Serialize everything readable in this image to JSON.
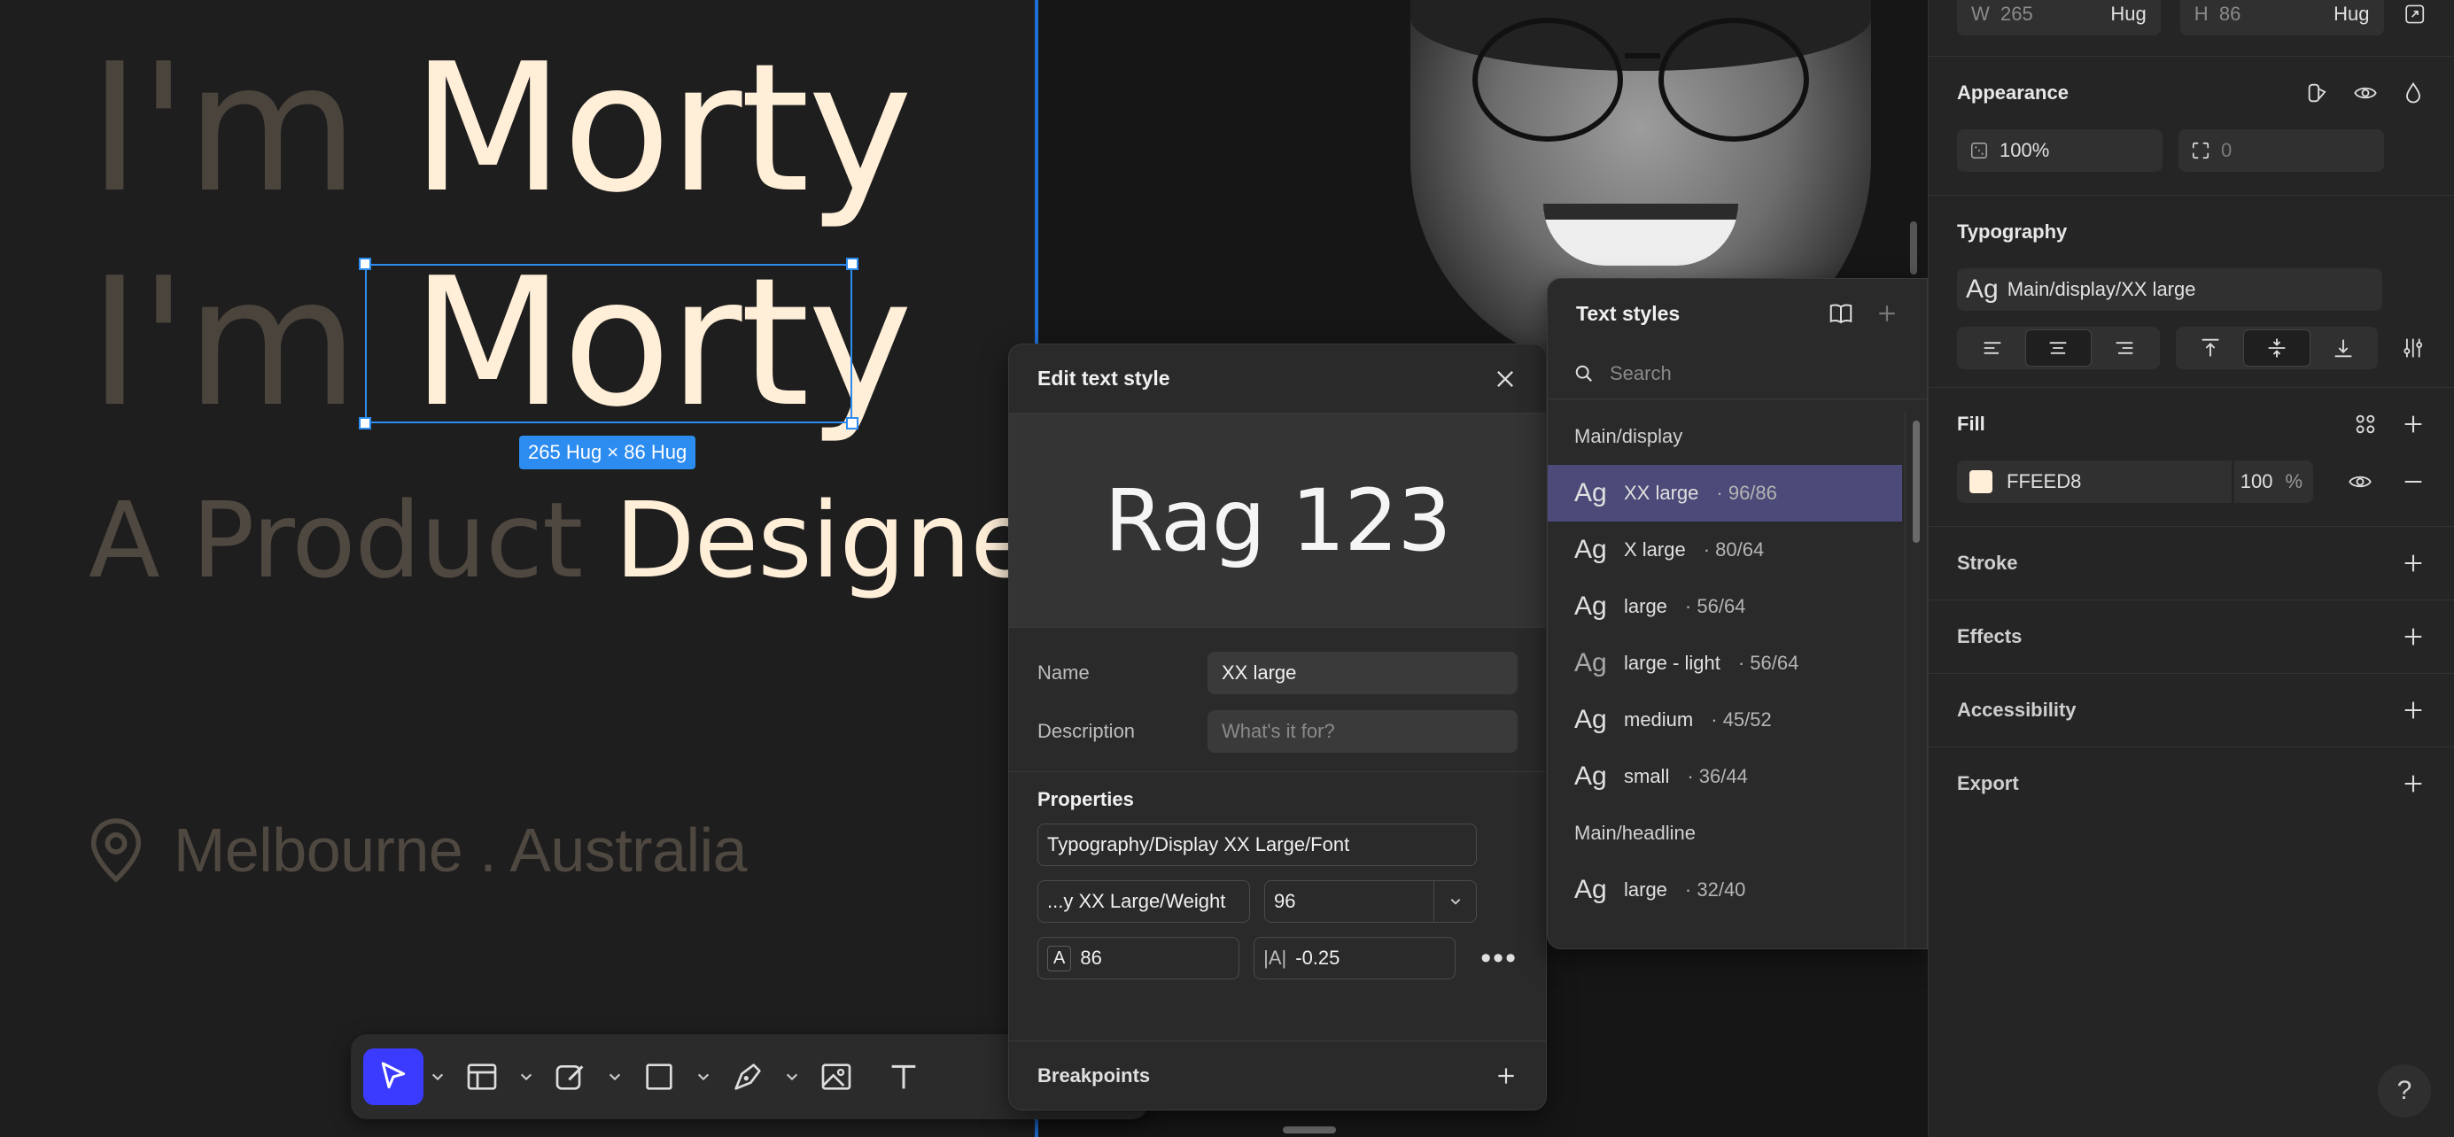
{
  "canvas": {
    "line1": {
      "dim": "I'm",
      "bright": "Morty"
    },
    "line2": {
      "dim": "I'm",
      "bright": "Morty"
    },
    "line3": {
      "dim": "A Product",
      "bright": "Designer"
    },
    "location": "Melbourne . Australia",
    "selection_badge": "265 Hug × 86 Hug"
  },
  "toolbar": {
    "tools": [
      "select-tool",
      "frame-tool",
      "component-tool",
      "shape-tool",
      "pen-tool",
      "image-tool",
      "text-tool"
    ]
  },
  "edit_text_style": {
    "title": "Edit text style",
    "preview": "Rag 123",
    "name_label": "Name",
    "name_value": "XX large",
    "description_label": "Description",
    "description_placeholder": "What's it for?",
    "properties_title": "Properties",
    "font_token": "Typography/Display XX Large/Font",
    "weight_token": "...y XX Large/Weight",
    "font_size": "96",
    "line_height": "86",
    "letter_spacing": "-0.25",
    "breakpoints_title": "Breakpoints"
  },
  "text_styles": {
    "title": "Text styles",
    "search_placeholder": "Search",
    "groups": [
      {
        "name": "Main/display",
        "items": [
          {
            "ag": "Ag",
            "label": "XX large",
            "meta": "· 96/86",
            "selected": true
          },
          {
            "ag": "Ag",
            "label": "X large",
            "meta": "· 80/64"
          },
          {
            "ag": "Ag",
            "label": "large",
            "meta": "· 56/64"
          },
          {
            "ag": "Ag",
            "label": "large - light",
            "meta": "· 56/64"
          },
          {
            "ag": "Ag",
            "label": "medium",
            "meta": "· 45/52"
          },
          {
            "ag": "Ag",
            "label": "small",
            "meta": "· 36/44"
          }
        ]
      },
      {
        "name": "Main/headline",
        "items": [
          {
            "ag": "Ag",
            "label": "large",
            "meta": "· 32/40"
          }
        ]
      }
    ]
  },
  "inspector": {
    "w_label": "W",
    "w_value": "265",
    "w_mode": "Hug",
    "h_label": "H",
    "h_value": "86",
    "h_mode": "Hug",
    "appearance_title": "Appearance",
    "opacity": "100%",
    "corner_radius": "0",
    "typography_title": "Typography",
    "typography_style": "Main/display/XX large",
    "typography_ag": "Ag",
    "fill_title": "Fill",
    "fill_hex": "FFEED8",
    "fill_opacity": "100",
    "fill_percent": "%",
    "fill_color": "#ffeed8",
    "stroke_title": "Stroke",
    "effects_title": "Effects",
    "accessibility_title": "Accessibility",
    "export_title": "Export",
    "help": "?"
  },
  "colors": {
    "accent_blue": "#2d8cf0",
    "active_tool": "#3b3bff",
    "selected_row": "#4b4a78",
    "hero_text": "#ffeed8"
  }
}
